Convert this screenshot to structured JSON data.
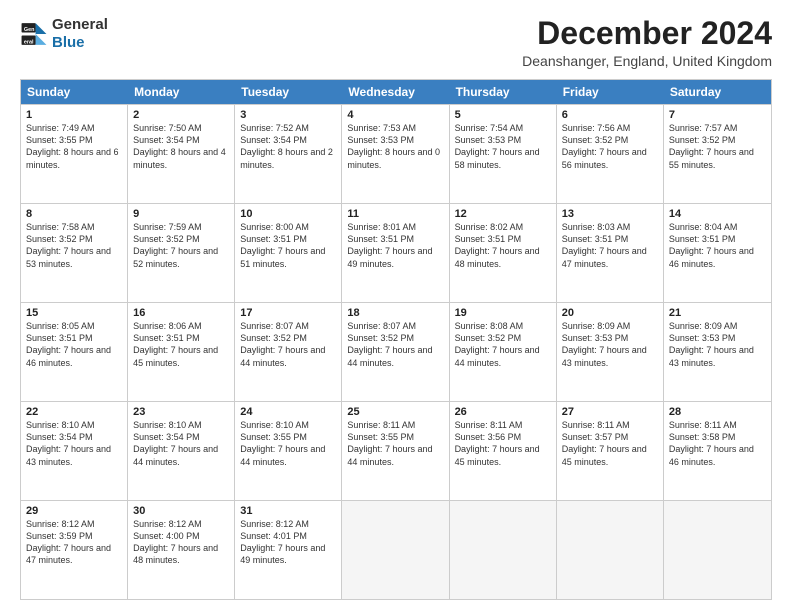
{
  "header": {
    "logo_line1": "General",
    "logo_line2": "Blue",
    "month_title": "December 2024",
    "location": "Deanshanger, England, United Kingdom"
  },
  "days_of_week": [
    "Sunday",
    "Monday",
    "Tuesday",
    "Wednesday",
    "Thursday",
    "Friday",
    "Saturday"
  ],
  "weeks": [
    [
      {
        "day": "1",
        "sunrise": "7:49 AM",
        "sunset": "3:55 PM",
        "daylight": "8 hours and 6 minutes."
      },
      {
        "day": "2",
        "sunrise": "7:50 AM",
        "sunset": "3:54 PM",
        "daylight": "8 hours and 4 minutes."
      },
      {
        "day": "3",
        "sunrise": "7:52 AM",
        "sunset": "3:54 PM",
        "daylight": "8 hours and 2 minutes."
      },
      {
        "day": "4",
        "sunrise": "7:53 AM",
        "sunset": "3:53 PM",
        "daylight": "8 hours and 0 minutes."
      },
      {
        "day": "5",
        "sunrise": "7:54 AM",
        "sunset": "3:53 PM",
        "daylight": "7 hours and 58 minutes."
      },
      {
        "day": "6",
        "sunrise": "7:56 AM",
        "sunset": "3:52 PM",
        "daylight": "7 hours and 56 minutes."
      },
      {
        "day": "7",
        "sunrise": "7:57 AM",
        "sunset": "3:52 PM",
        "daylight": "7 hours and 55 minutes."
      }
    ],
    [
      {
        "day": "8",
        "sunrise": "7:58 AM",
        "sunset": "3:52 PM",
        "daylight": "7 hours and 53 minutes."
      },
      {
        "day": "9",
        "sunrise": "7:59 AM",
        "sunset": "3:52 PM",
        "daylight": "7 hours and 52 minutes."
      },
      {
        "day": "10",
        "sunrise": "8:00 AM",
        "sunset": "3:51 PM",
        "daylight": "7 hours and 51 minutes."
      },
      {
        "day": "11",
        "sunrise": "8:01 AM",
        "sunset": "3:51 PM",
        "daylight": "7 hours and 49 minutes."
      },
      {
        "day": "12",
        "sunrise": "8:02 AM",
        "sunset": "3:51 PM",
        "daylight": "7 hours and 48 minutes."
      },
      {
        "day": "13",
        "sunrise": "8:03 AM",
        "sunset": "3:51 PM",
        "daylight": "7 hours and 47 minutes."
      },
      {
        "day": "14",
        "sunrise": "8:04 AM",
        "sunset": "3:51 PM",
        "daylight": "7 hours and 46 minutes."
      }
    ],
    [
      {
        "day": "15",
        "sunrise": "8:05 AM",
        "sunset": "3:51 PM",
        "daylight": "7 hours and 46 minutes."
      },
      {
        "day": "16",
        "sunrise": "8:06 AM",
        "sunset": "3:51 PM",
        "daylight": "7 hours and 45 minutes."
      },
      {
        "day": "17",
        "sunrise": "8:07 AM",
        "sunset": "3:52 PM",
        "daylight": "7 hours and 44 minutes."
      },
      {
        "day": "18",
        "sunrise": "8:07 AM",
        "sunset": "3:52 PM",
        "daylight": "7 hours and 44 minutes."
      },
      {
        "day": "19",
        "sunrise": "8:08 AM",
        "sunset": "3:52 PM",
        "daylight": "7 hours and 44 minutes."
      },
      {
        "day": "20",
        "sunrise": "8:09 AM",
        "sunset": "3:53 PM",
        "daylight": "7 hours and 43 minutes."
      },
      {
        "day": "21",
        "sunrise": "8:09 AM",
        "sunset": "3:53 PM",
        "daylight": "7 hours and 43 minutes."
      }
    ],
    [
      {
        "day": "22",
        "sunrise": "8:10 AM",
        "sunset": "3:54 PM",
        "daylight": "7 hours and 43 minutes."
      },
      {
        "day": "23",
        "sunrise": "8:10 AM",
        "sunset": "3:54 PM",
        "daylight": "7 hours and 44 minutes."
      },
      {
        "day": "24",
        "sunrise": "8:10 AM",
        "sunset": "3:55 PM",
        "daylight": "7 hours and 44 minutes."
      },
      {
        "day": "25",
        "sunrise": "8:11 AM",
        "sunset": "3:55 PM",
        "daylight": "7 hours and 44 minutes."
      },
      {
        "day": "26",
        "sunrise": "8:11 AM",
        "sunset": "3:56 PM",
        "daylight": "7 hours and 45 minutes."
      },
      {
        "day": "27",
        "sunrise": "8:11 AM",
        "sunset": "3:57 PM",
        "daylight": "7 hours and 45 minutes."
      },
      {
        "day": "28",
        "sunrise": "8:11 AM",
        "sunset": "3:58 PM",
        "daylight": "7 hours and 46 minutes."
      }
    ],
    [
      {
        "day": "29",
        "sunrise": "8:12 AM",
        "sunset": "3:59 PM",
        "daylight": "7 hours and 47 minutes."
      },
      {
        "day": "30",
        "sunrise": "8:12 AM",
        "sunset": "4:00 PM",
        "daylight": "7 hours and 48 minutes."
      },
      {
        "day": "31",
        "sunrise": "8:12 AM",
        "sunset": "4:01 PM",
        "daylight": "7 hours and 49 minutes."
      },
      null,
      null,
      null,
      null
    ]
  ]
}
